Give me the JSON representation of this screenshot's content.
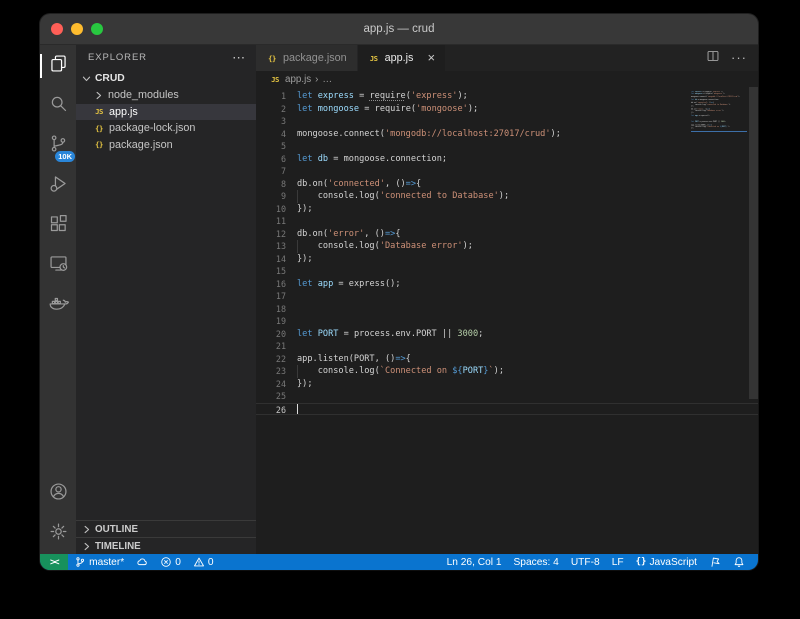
{
  "colors": {
    "status_blue": "#0a74cf",
    "remote_green": "#17915c",
    "badge_blue": "#2a86d9",
    "file_icon_yellow": "#e3c342",
    "keyword": "#569cd6",
    "variable": "#9cdcfe",
    "plain": "#d4d4d4",
    "string": "#ce9178",
    "number": "#b5cea8",
    "traffic_close": "#ff5f57",
    "traffic_minimize": "#febc2e",
    "traffic_zoom": "#28c840"
  },
  "window": {
    "title": "app.js — crud"
  },
  "activity_bar": {
    "top": [
      {
        "name": "explorer",
        "icon": "files-icon",
        "active": true
      },
      {
        "name": "search",
        "icon": "search-icon"
      },
      {
        "name": "source-control",
        "icon": "source-control-icon",
        "badge": "10K"
      },
      {
        "name": "run-debug",
        "icon": "run-debug-icon"
      },
      {
        "name": "extensions",
        "icon": "extensions-icon"
      },
      {
        "name": "remote-explorer",
        "icon": "remote-explorer-icon"
      },
      {
        "name": "docker",
        "icon": "docker-icon"
      }
    ],
    "bottom": [
      {
        "name": "accounts",
        "icon": "account-icon"
      },
      {
        "name": "settings",
        "icon": "settings-gear-icon"
      }
    ]
  },
  "sidebar": {
    "header": {
      "title": "EXPLORER",
      "more": "⋯"
    },
    "root": {
      "label": "CRUD"
    },
    "items": [
      {
        "label": "node_modules",
        "icon": "chevron-right-icon",
        "kind": "folder"
      },
      {
        "label": "app.js",
        "icon": "js-file-icon",
        "glyph": "JS",
        "selected": true
      },
      {
        "label": "package-lock.json",
        "icon": "json-file-icon",
        "glyph": "{}"
      },
      {
        "label": "package.json",
        "icon": "json-file-icon",
        "glyph": "{}"
      }
    ],
    "bottom_sections": [
      {
        "label": "OUTLINE"
      },
      {
        "label": "TIMELINE"
      }
    ]
  },
  "tabs": [
    {
      "label": "package.json",
      "icon": "json-file-icon",
      "glyph": "{}",
      "active": false
    },
    {
      "label": "app.js",
      "icon": "js-file-icon",
      "glyph": "JS",
      "active": true,
      "close_glyph": "×"
    }
  ],
  "editor_actions": {
    "split_icon": "split-editor-icon",
    "more": "···"
  },
  "breadcrumb": {
    "glyph": "JS",
    "file": "app.js",
    "separator": "›",
    "more": "…"
  },
  "code": {
    "lines": [
      {
        "n": 1,
        "seg": [
          [
            "let",
            "k"
          ],
          [
            " ",
            "p"
          ],
          [
            "express",
            "v"
          ],
          [
            " = ",
            "p"
          ],
          [
            "require",
            "p u"
          ],
          [
            "(",
            "p"
          ],
          [
            "'express'",
            "s"
          ],
          [
            ");",
            "p"
          ]
        ]
      },
      {
        "n": 2,
        "seg": [
          [
            "let",
            "k"
          ],
          [
            " ",
            "p"
          ],
          [
            "mongoose",
            "v"
          ],
          [
            " = ",
            "p"
          ],
          [
            "require",
            "p"
          ],
          [
            "(",
            "p"
          ],
          [
            "'mongoose'",
            "s"
          ],
          [
            ");",
            "p"
          ]
        ]
      },
      {
        "n": 3,
        "seg": []
      },
      {
        "n": 4,
        "seg": [
          [
            "mongoose.connect(",
            "p"
          ],
          [
            "'mongodb://localhost:27017/crud'",
            "s"
          ],
          [
            ");",
            "p"
          ]
        ]
      },
      {
        "n": 5,
        "seg": []
      },
      {
        "n": 6,
        "seg": [
          [
            "let",
            "k"
          ],
          [
            " ",
            "p"
          ],
          [
            "db",
            "v"
          ],
          [
            " = mongoose.connection;",
            "p"
          ]
        ]
      },
      {
        "n": 7,
        "seg": []
      },
      {
        "n": 8,
        "seg": [
          [
            "db.on(",
            "p"
          ],
          [
            "'connected'",
            "s"
          ],
          [
            ", ()",
            "p"
          ],
          [
            "=>",
            "k"
          ],
          [
            "{",
            "p"
          ]
        ]
      },
      {
        "n": 9,
        "guide": true,
        "seg": [
          [
            "    console.log(",
            "p"
          ],
          [
            "'connected to Database'",
            "s"
          ],
          [
            ");",
            "p"
          ]
        ]
      },
      {
        "n": 10,
        "seg": [
          [
            "});",
            "p"
          ]
        ]
      },
      {
        "n": 11,
        "seg": []
      },
      {
        "n": 12,
        "seg": [
          [
            "db.on(",
            "p"
          ],
          [
            "'error'",
            "s"
          ],
          [
            ", ()",
            "p"
          ],
          [
            "=>",
            "k"
          ],
          [
            "{",
            "p"
          ]
        ]
      },
      {
        "n": 13,
        "guide": true,
        "seg": [
          [
            "    console.log(",
            "p"
          ],
          [
            "'Database error'",
            "s"
          ],
          [
            ");",
            "p"
          ]
        ]
      },
      {
        "n": 14,
        "seg": [
          [
            "});",
            "p"
          ]
        ]
      },
      {
        "n": 15,
        "seg": []
      },
      {
        "n": 16,
        "seg": [
          [
            "let",
            "k"
          ],
          [
            " ",
            "p"
          ],
          [
            "app",
            "v"
          ],
          [
            " = express();",
            "p"
          ]
        ]
      },
      {
        "n": 17,
        "seg": []
      },
      {
        "n": 18,
        "seg": []
      },
      {
        "n": 19,
        "seg": []
      },
      {
        "n": 20,
        "seg": [
          [
            "let",
            "k"
          ],
          [
            " ",
            "p"
          ],
          [
            "PORT",
            "v"
          ],
          [
            " = process.env.PORT || ",
            "p"
          ],
          [
            "3000",
            "n_"
          ],
          [
            ";",
            "p"
          ]
        ]
      },
      {
        "n": 21,
        "seg": []
      },
      {
        "n": 22,
        "seg": [
          [
            "app.listen(PORT, ()",
            "p"
          ],
          [
            "=>",
            "k"
          ],
          [
            "{",
            "p"
          ]
        ]
      },
      {
        "n": 23,
        "guide": true,
        "seg": [
          [
            "    console.log(",
            "p"
          ],
          [
            "`Connected on ",
            "s"
          ],
          [
            "${",
            "k"
          ],
          [
            "PORT",
            "v"
          ],
          [
            "}",
            "k"
          ],
          [
            "`",
            "s"
          ],
          [
            ");",
            "p"
          ]
        ]
      },
      {
        "n": 24,
        "seg": [
          [
            "});",
            "p"
          ]
        ]
      },
      {
        "n": 25,
        "seg": []
      },
      {
        "n": 26,
        "current": true,
        "cursor": true,
        "seg": []
      }
    ]
  },
  "status_bar": {
    "remote": {
      "name": "remote-indicator",
      "glyph": "><"
    },
    "left": [
      {
        "name": "branch-indicator",
        "icon": "git-branch-icon",
        "label": "master*"
      },
      {
        "name": "sync-publish",
        "icon": "sync-cloud-icon",
        "label": ""
      },
      {
        "name": "errors",
        "icon": "error-icon",
        "label": "0"
      },
      {
        "name": "warnings",
        "icon": "warning-icon",
        "label": "0"
      }
    ],
    "right": [
      {
        "name": "cursor-position",
        "label": "Ln 26, Col 1"
      },
      {
        "name": "indentation",
        "label": "Spaces: 4"
      },
      {
        "name": "encoding",
        "label": "UTF-8"
      },
      {
        "name": "eol",
        "label": "LF"
      },
      {
        "name": "language-mode",
        "glyph": "{}",
        "label": "JavaScript"
      },
      {
        "name": "feedback",
        "icon": "feedback-icon",
        "label": ""
      },
      {
        "name": "notifications",
        "icon": "bell-icon",
        "label": ""
      }
    ]
  }
}
